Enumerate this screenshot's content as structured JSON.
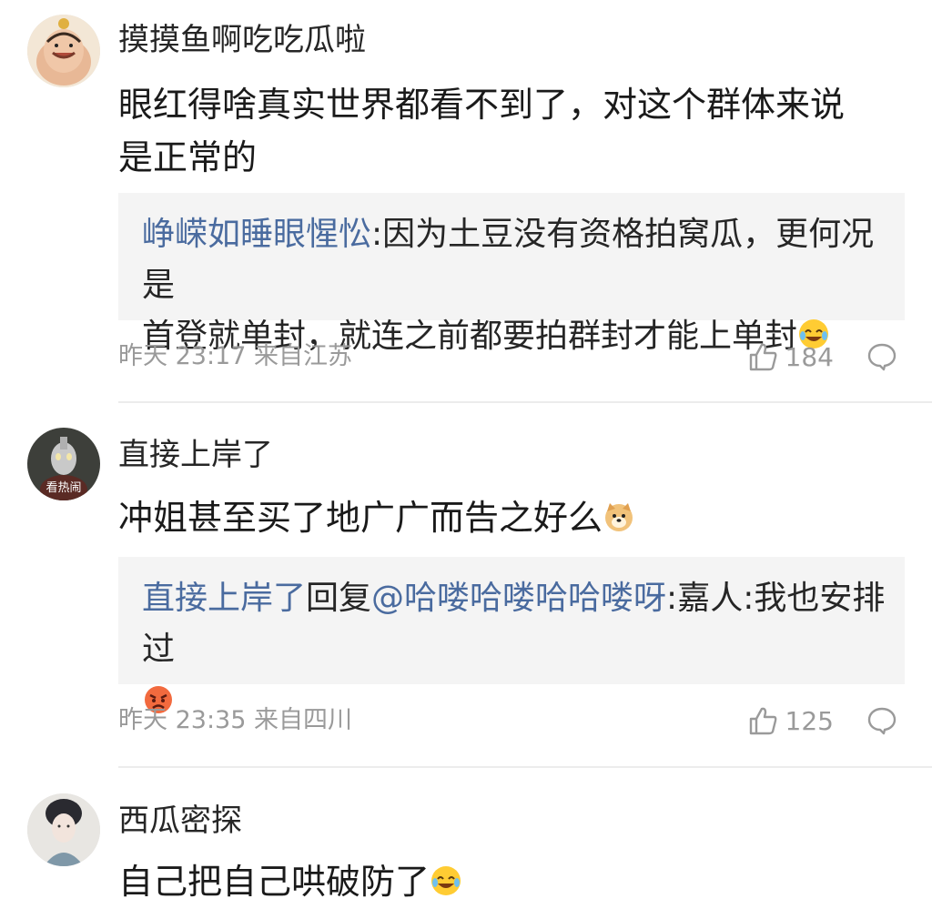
{
  "comments": [
    {
      "username": "摸摸鱼啊吃吃瓜啦",
      "text_line1": "眼红得啥真实世界都看不到了，对这个群体来说",
      "text_line2": "是正常的",
      "reply": {
        "author": "峥嵘如睡眼惺忪",
        "separator": ":",
        "text_line1": "因为土豆没有资格拍窝瓜，更何况是",
        "text_line2": "首登就单封，就连之前都要拍群封才能上单封"
      },
      "time": "昨天 23:17",
      "location": "来自江苏",
      "likes": "184"
    },
    {
      "username": "直接上岸了",
      "avatar_badge": "看热闹",
      "text_line1": "冲姐甚至买了地广广而告之好么",
      "reply": {
        "author": "直接上岸了",
        "action": "回复",
        "mention": "@哈喽哈喽哈哈喽呀",
        "separator": ":",
        "text_line1": "嘉人:我也安排过"
      },
      "time": "昨天 23:35",
      "location": "来自四川",
      "likes": "125"
    },
    {
      "username": "西瓜密探",
      "text_line1": "自己把自己哄破防了"
    }
  ],
  "colors": {
    "link": "#4a6b9f",
    "meta": "#9a9a9a",
    "reply_bg": "#f4f4f4"
  },
  "icons": [
    "like-icon",
    "comment-icon",
    "laugh-cry-emoji",
    "doge-emoji",
    "angry-emoji"
  ]
}
